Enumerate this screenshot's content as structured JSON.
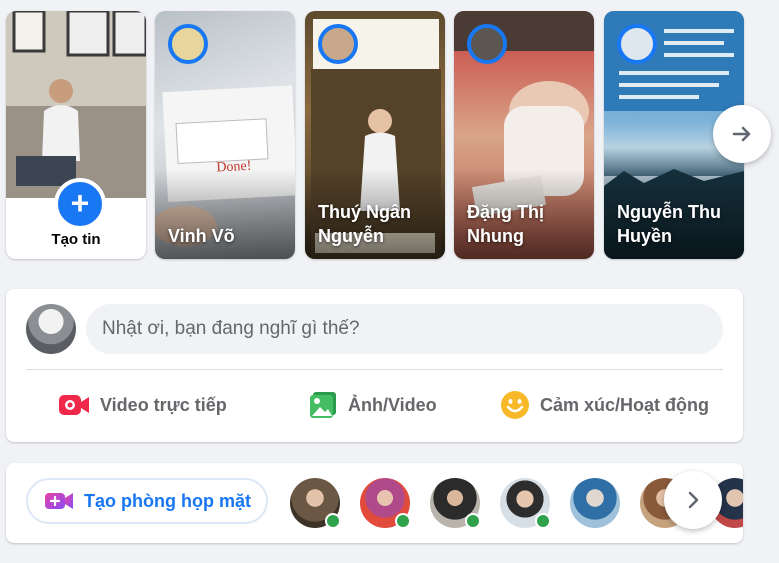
{
  "stories": {
    "create_label": "Tạo tin",
    "items": [
      {
        "name": "Vinh Võ"
      },
      {
        "name": "Thuý Ngân Nguyễn"
      },
      {
        "name": "Đặng Thị Nhung"
      },
      {
        "name": "Nguyễn Thu Huyền"
      }
    ]
  },
  "composer": {
    "placeholder": "Nhật ơi, bạn đang nghĩ gì thế?",
    "actions": {
      "live": "Video trực tiếp",
      "photo": "Ảnh/Video",
      "feeling": "Cảm xúc/Hoạt động"
    }
  },
  "rooms": {
    "create_label": "Tạo phòng họp mặt"
  },
  "colors": {
    "accent": "#1877f2",
    "live": "#f02849",
    "photo": "#45bd62",
    "feeling": "#f7b928",
    "online": "#31a24c"
  },
  "icons": [
    "plus-icon",
    "arrow-right-icon",
    "video-camera-icon",
    "photo-icon",
    "smiley-icon",
    "video-room-icon",
    "chevron-right-icon"
  ]
}
